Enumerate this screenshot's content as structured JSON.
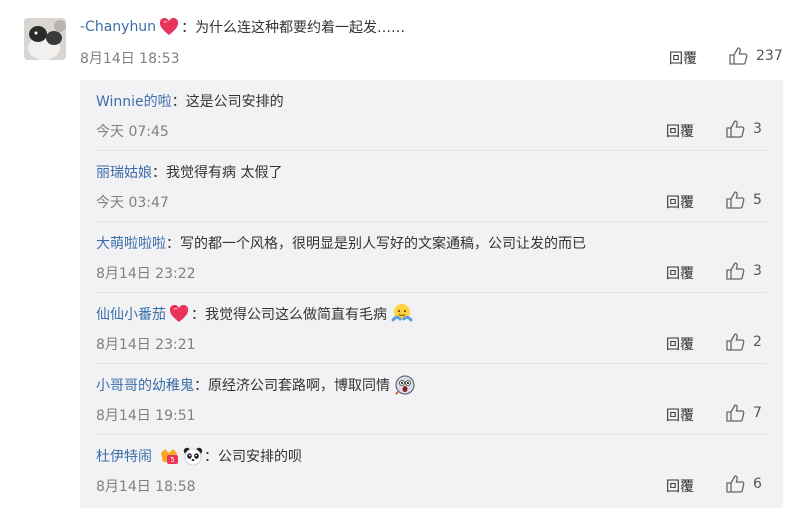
{
  "main_comment": {
    "username": "-Chanyhun",
    "colon": "：",
    "text": "为什么连这种都要约着一起发……",
    "time": "8月14日 18:53",
    "reply_label": "回覆",
    "likes": "237"
  },
  "replies": [
    {
      "username": "Winnie的啦",
      "colon": "：",
      "text": "这是公司安排的",
      "time": "今天 07:45",
      "reply_label": "回覆",
      "likes": "3"
    },
    {
      "username": "丽瑞姑娘",
      "colon": "：",
      "text": "我觉得有病 太假了",
      "time": "今天 03:47",
      "reply_label": "回覆",
      "likes": "5"
    },
    {
      "username": "大萌啦啦啦",
      "colon": "：",
      "text": "写的都一个风格，很明显是别人写好的文案通稿，公司让发的而已",
      "time": "8月14日 23:22",
      "reply_label": "回覆",
      "likes": "3"
    },
    {
      "username": "仙仙小番茄",
      "colon": "：",
      "text": "我觉得公司这么做简直有毛病",
      "time": "8月14日 23:21",
      "reply_label": "回覆",
      "likes": "2"
    },
    {
      "username": "小哥哥的幼稚鬼",
      "colon": "：",
      "text": "原经济公司套路啊，博取同情",
      "time": "8月14日 19:51",
      "reply_label": "回覆",
      "likes": "7"
    },
    {
      "username": "杜伊特闹",
      "colon": "：",
      "text": "公司安排的呗",
      "time": "8月14日 18:58",
      "reply_label": "回覆",
      "likes": "6"
    }
  ],
  "icons": {
    "like": "thumbs-up-icon",
    "heart": "heart-badge-icon",
    "hug": "hug-emoji-icon",
    "scared": "scared-emoji-icon",
    "panda": "panda-emoji-icon",
    "badge": "vip-badge-icon"
  },
  "colors": {
    "username": "#3b6ea8",
    "reply_bg": "#f2f2f5",
    "heart": "#e8335a"
  }
}
